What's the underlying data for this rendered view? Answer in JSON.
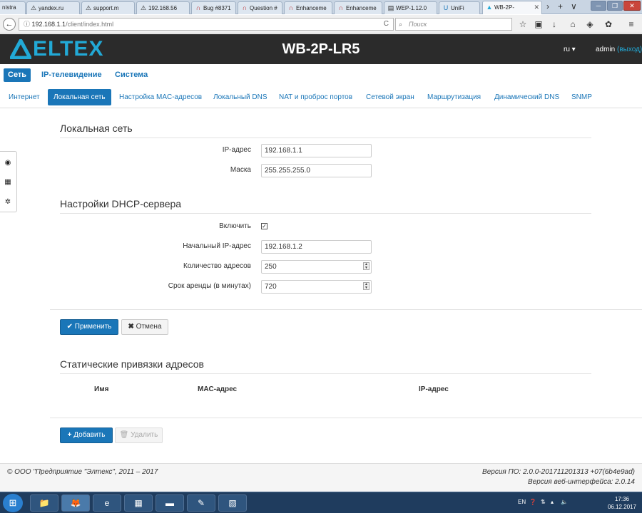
{
  "browser": {
    "tabs": [
      {
        "label": "nistra",
        "icon": "page-icon"
      },
      {
        "label": "yandex.ru",
        "icon": "warning-icon"
      },
      {
        "label": "support.m",
        "icon": "warning-icon"
      },
      {
        "label": "192.168.56",
        "icon": "warning-icon"
      },
      {
        "label": "Bug #8371",
        "icon": "redmine-icon"
      },
      {
        "label": "Question #",
        "icon": "redmine-icon"
      },
      {
        "label": "Enhanceme",
        "icon": "redmine-icon"
      },
      {
        "label": "Enhanceme",
        "icon": "redmine-icon"
      },
      {
        "label": "WEP-1.12.0",
        "icon": "page-icon"
      },
      {
        "label": "UniFi",
        "icon": "unifi-icon"
      },
      {
        "label": "WB-2P-",
        "icon": "eltex-icon"
      }
    ],
    "url_host": "192.168.1.1",
    "url_path": "/client/index.html",
    "search_placeholder": "Поиск"
  },
  "header": {
    "logo_text": "ELTEX",
    "device_title": "WB-2P-LR5",
    "language": "ru",
    "user": "admin",
    "logout": "(выход)"
  },
  "main_nav": [
    "Сеть",
    "IP-телевидение",
    "Система"
  ],
  "sub_nav": [
    "Интернет",
    "Локальная сеть",
    "Настройка MAC-адресов",
    "Локальный DNS",
    "NAT и проброс портов",
    "Сетевой экран",
    "Маршрутизация",
    "Динамический DNS",
    "SNMP"
  ],
  "lan": {
    "title": "Локальная сеть",
    "ip_label": "IP-адрес",
    "ip_value": "192.168.1.1",
    "mask_label": "Маска",
    "mask_value": "255.255.255.0"
  },
  "dhcp": {
    "title": "Настройки DHCP-сервера",
    "enable_label": "Включить",
    "enabled": true,
    "start_label": "Начальный IP-адрес",
    "start_value": "192.168.1.2",
    "count_label": "Количество адресов",
    "count_value": "250",
    "lease_label": "Срок аренды (в минутах)",
    "lease_value": "720"
  },
  "actions": {
    "apply": "Применить",
    "cancel": "Отмена"
  },
  "static": {
    "title": "Статические привязки адресов",
    "col_name": "Имя",
    "col_mac": "MAC-адрес",
    "col_ip": "IP-адрес",
    "add": "Добавить",
    "delete": "Удалить"
  },
  "footer": {
    "copyright": "© ООО \"Предприятие \"Элтекс\", 2011 – 2017",
    "fw_version": "Версия ПО: 2.0.0-201711201313 +07(6b4e9ad)",
    "web_version": "Версия веб-интерфейса: 2.0.14"
  },
  "taskbar": {
    "lang": "EN",
    "time": "17:36",
    "date": "06.12.2017"
  }
}
